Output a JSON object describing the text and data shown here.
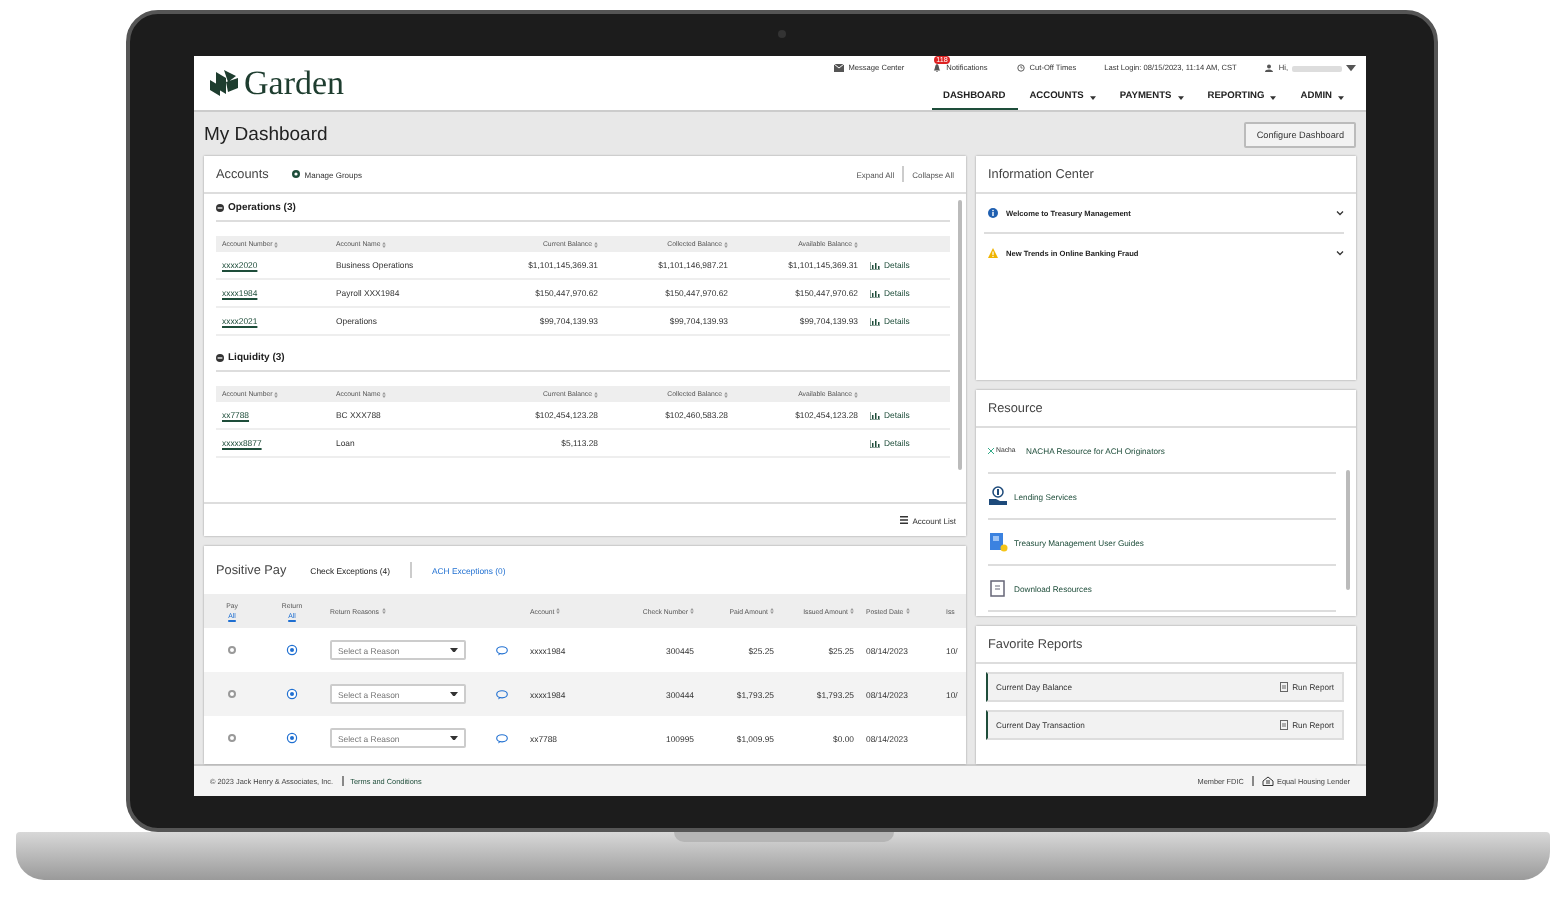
{
  "header": {
    "logo": "Garden",
    "links": [
      {
        "kind": "mail",
        "label": "Message Center"
      },
      {
        "kind": "bell",
        "label": "Notifications",
        "badge": "118"
      },
      {
        "kind": "clock",
        "label": "Cut-Off Times"
      },
      {
        "kind": "text",
        "label": "Last Login: 08/15/2023, 11:14 AM, CST"
      },
      {
        "kind": "user",
        "label": "Hi,"
      }
    ],
    "nav": [
      {
        "label": "DASHBOARD",
        "selected": true,
        "dropdown": false
      },
      {
        "label": "ACCOUNTS",
        "selected": false,
        "dropdown": true
      },
      {
        "label": "PAYMENTS",
        "selected": false,
        "dropdown": true
      },
      {
        "label": "REPORTING",
        "selected": false,
        "dropdown": true
      },
      {
        "label": "ADMIN",
        "selected": false,
        "dropdown": true
      }
    ]
  },
  "page_title": "My Dashboard",
  "configure_button": "Configure Dashboard",
  "accounts": {
    "title": "Accounts",
    "manage": "Manage Groups",
    "expand": "Expand All",
    "collapse": "Collapse All",
    "groups": [
      {
        "name": "Operations (3)",
        "columns": [
          "Account Number",
          "Account Name",
          "Current Balance",
          "Collected Balance",
          "Available Balance"
        ],
        "rows": [
          {
            "number": "xxxx2020",
            "name": "Business Operations",
            "current": "$1,101,145,369.31",
            "collected": "$1,101,146,987.21",
            "available": "$1,101,145,369.31",
            "details": "Details"
          },
          {
            "number": "xxxx1984",
            "name": "Payroll XXX1984",
            "current": "$150,447,970.62",
            "collected": "$150,447,970.62",
            "available": "$150,447,970.62",
            "details": "Details"
          },
          {
            "number": "xxxx2021",
            "name": "Operations",
            "current": "$99,704,139.93",
            "collected": "$99,704,139.93",
            "available": "$99,704,139.93",
            "details": "Details"
          }
        ]
      },
      {
        "name": "Liquidity (3)",
        "columns": [
          "Account Number",
          "Account Name",
          "Current Balance",
          "Collected Balance",
          "Available Balance"
        ],
        "rows": [
          {
            "number": "xx7788",
            "name": "BC XXX788",
            "current": "$102,454,123.28",
            "collected": "$102,460,583.28",
            "available": "$102,454,123.28",
            "details": "Details"
          },
          {
            "number": "xxxxx8877",
            "name": "Loan",
            "current": "$5,113.28",
            "collected": "",
            "available": "",
            "details": "Details"
          }
        ]
      }
    ],
    "account_list": "Account List"
  },
  "positive_pay": {
    "title": "Positive Pay",
    "tabs": [
      {
        "label": "Check Exceptions (4)",
        "selected": true
      },
      {
        "label": "ACH Exceptions (0)",
        "selected": false
      }
    ],
    "pay_header": {
      "label": "Pay",
      "link": "All"
    },
    "return_header": {
      "label": "Return",
      "link": "All"
    },
    "columns": [
      "Return Reasons",
      "Account",
      "Check Number",
      "Paid Amount",
      "Issued Amount",
      "Posted Date",
      "Iss"
    ],
    "rows": [
      {
        "pay": {
          "selected": false
        },
        "return": {
          "selected": true
        },
        "reason_placeholder": "Select a Reason",
        "account": "xxxx1984",
        "check": "300445",
        "paid": "$25.25",
        "issued": "$25.25",
        "posted": "08/14/2023",
        "column_9": "10/"
      },
      {
        "pay": {
          "selected": false
        },
        "return": {
          "selected": true
        },
        "reason_placeholder": "Select a Reason",
        "account": "xxxx1984",
        "check": "300444",
        "paid": "$1,793.25",
        "issued": "$1,793.25",
        "posted": "08/14/2023",
        "column_9": "10/"
      },
      {
        "pay": {
          "selected": false
        },
        "return": {
          "selected": true
        },
        "reason_placeholder": "Select a Reason",
        "account": "xx7788",
        "check": "100995",
        "paid": "$1,009.95",
        "issued": "$0.00",
        "posted": "08/14/2023",
        "column_9": ""
      }
    ]
  },
  "information_center": {
    "title": "Information Center",
    "items": [
      {
        "kind": "info",
        "label": "Welcome to Treasury Management"
      },
      {
        "kind": "warning",
        "label": "New Trends in Online Banking Fraud"
      }
    ]
  },
  "resource": {
    "title": "Resource",
    "items": [
      {
        "kind": "nacha",
        "logo_text": "Nacha",
        "label": "NACHA Resource for ACH Originators"
      },
      {
        "kind": "lending",
        "label": "Lending Services"
      },
      {
        "kind": "guide",
        "label": "Treasury Management User Guides"
      },
      {
        "kind": "download",
        "label": "Download Resources"
      }
    ]
  },
  "favorite_reports": {
    "title": "Favorite Reports",
    "items": [
      {
        "label": "Current Day Balance",
        "action": "Run Report"
      },
      {
        "label": "Current Day Transaction",
        "action": "Run Report"
      }
    ]
  },
  "footer": {
    "copyright": "© 2023 Jack Henry & Associates, Inc.",
    "terms": "Terms and Conditions",
    "fdic": "Member FDIC",
    "housing": "Equal Housing Lender"
  }
}
